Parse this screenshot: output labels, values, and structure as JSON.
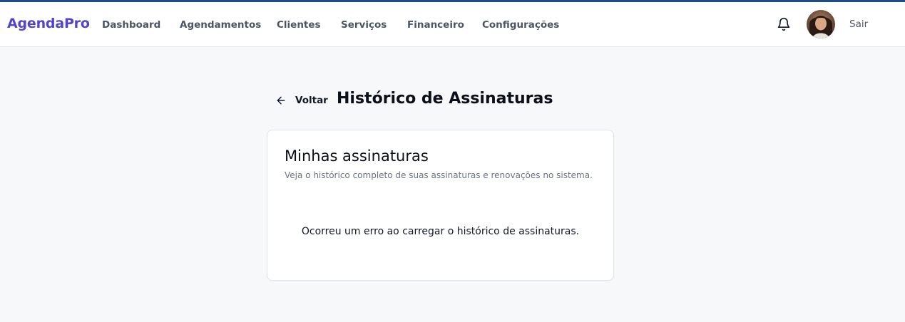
{
  "header": {
    "brand": "AgendaPro",
    "nav": [
      {
        "label": "Dashboard"
      },
      {
        "label": "Agendamentos"
      },
      {
        "label": "Clientes"
      },
      {
        "label": "Serviços"
      },
      {
        "label": "Financeiro"
      },
      {
        "label": "Configurações"
      }
    ],
    "notification_icon": "bell-icon",
    "avatar_icon": "user-avatar",
    "logout_label": "Sair"
  },
  "page": {
    "back_label": "Voltar",
    "back_icon": "arrow-left-icon",
    "title": "Histórico de Assinaturas"
  },
  "card": {
    "title": "Minhas assinaturas",
    "subtitle": "Veja o histórico completo de suas assinaturas e renovações no sistema.",
    "error_message": "Ocorreu um erro ao carregar o histórico de assinaturas."
  },
  "colors": {
    "brand": "#5145cd",
    "top_accent": "#1e4a8a",
    "page_background": "#f7f8fa",
    "nav_text": "#4b5563"
  }
}
